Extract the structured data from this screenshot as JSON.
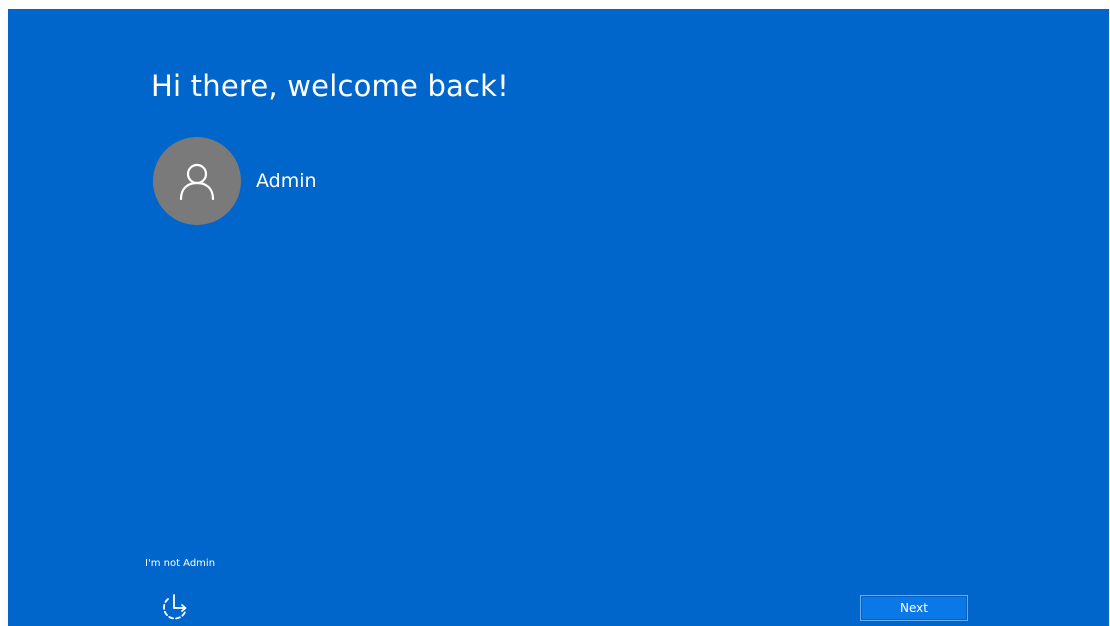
{
  "colors": {
    "background": "#0066cc",
    "avatar": "#7a7a7a",
    "button": "#0a78e6",
    "text": "#ffffff"
  },
  "welcome": {
    "greeting": "Hi there, welcome back!"
  },
  "user": {
    "name": "Admin",
    "avatar_icon": "person-icon"
  },
  "footer": {
    "not_user_link": "I'm not Admin",
    "ease_of_access_icon": "ease-of-access-icon",
    "next_label": "Next"
  }
}
